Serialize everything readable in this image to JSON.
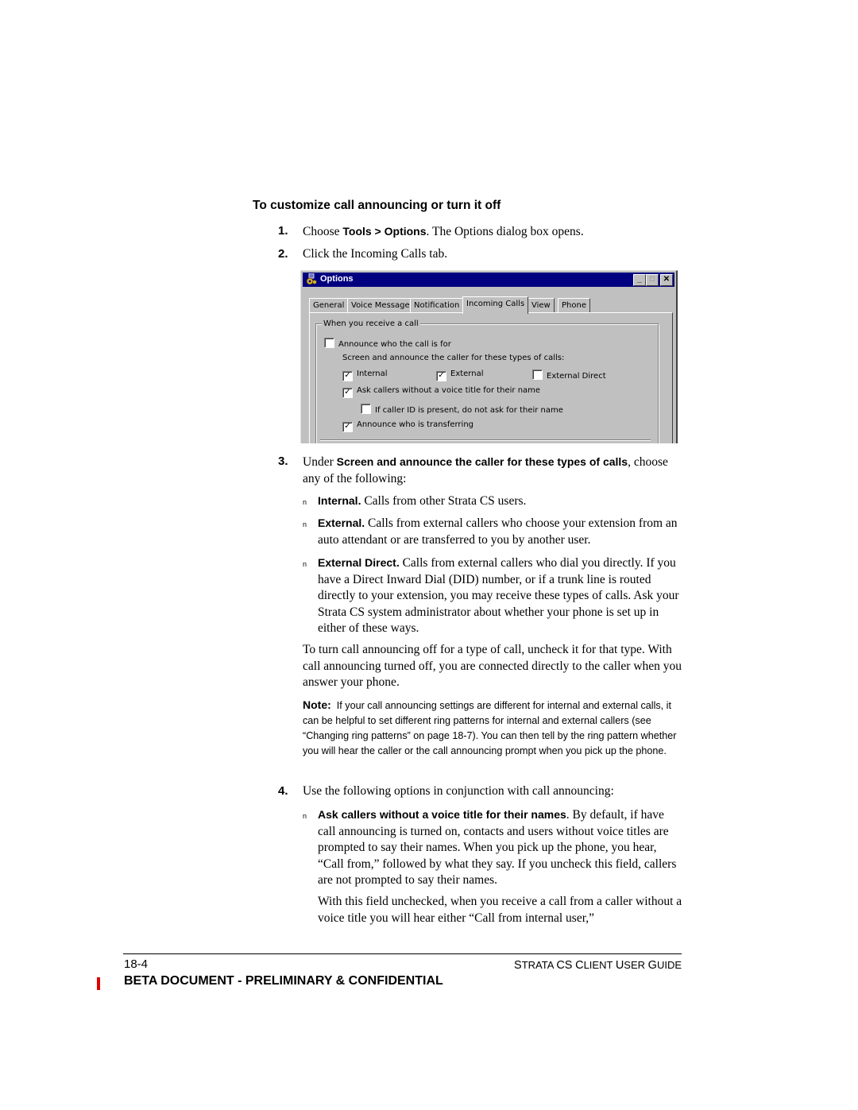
{
  "heading": "To customize call announcing or turn it off",
  "steps": [
    {
      "num": "1.",
      "pre": "Choose ",
      "bold": "Tools > Options",
      "post": ". The Options dialog box opens."
    },
    {
      "num": "2.",
      "text": "Click the Incoming Calls tab."
    },
    {
      "num": "3.",
      "pre": "Under ",
      "bold": "Screen and announce the caller for these types of calls",
      "post": ", choose any of the following:"
    },
    {
      "num": "4.",
      "text": "Use the following options in conjunction with call announcing:"
    }
  ],
  "bullet_marker": "n",
  "step3_bullets": [
    {
      "bold": "Internal.",
      "text": " Calls from other Strata CS users."
    },
    {
      "bold": "External.",
      "text": " Calls from external callers who choose your extension from an auto attendant or are transferred to you by another user."
    },
    {
      "bold": "External Direct.",
      "text": " Calls from external callers who dial you directly. If you have a Direct Inward Dial (DID) number, or if a trunk line is routed directly to your extension, you may receive these types of calls. Ask your Strata CS system administrator about whether your phone is set up in either of these ways."
    }
  ],
  "turn_off_para": "To turn call announcing off for a type of call, uncheck it for that type. With call announcing turned off, you are connected directly to the caller when you answer your phone.",
  "note": {
    "label": "Note:",
    "text": "If your call announcing settings are different for internal and external calls, it can be helpful to set different ring patterns for internal and external callers (see “Changing ring patterns” on page 18-7). You can then tell by the ring pattern whether you will hear the caller or the call announcing prompt when you pick up the phone."
  },
  "step4_bullets": [
    {
      "bold": "Ask callers without a voice title for their names",
      "text": ". By default, if have call announcing is turned on, contacts and users without voice titles are prompted to say their names. When you pick up the phone, you hear, “Call from,” followed by what they say. If you uncheck this field, callers are not prompted to say their names."
    }
  ],
  "step4_followup": "With this field unchecked, when you receive a call from a caller without a voice title you will hear either “Call from internal user,”",
  "dialog": {
    "title": "Options",
    "icon": "options-gear-icon",
    "controls": {
      "minimize": "_",
      "maximize": "□",
      "close": "✕"
    },
    "tabs": [
      {
        "label": "General",
        "active": false
      },
      {
        "label": "Voice Message",
        "active": false
      },
      {
        "label": "Notification",
        "active": false
      },
      {
        "label": "Incoming Calls",
        "active": true
      },
      {
        "label": "View",
        "active": false
      },
      {
        "label": "Phone",
        "active": false
      }
    ],
    "group_label": "When you receive a call",
    "announce_who_for": {
      "label": "Announce who the call is for",
      "checked": false
    },
    "screen_label": "Screen and announce the caller for these types of calls:",
    "types": [
      {
        "label": "Internal",
        "checked": true
      },
      {
        "label": "External",
        "checked": true
      },
      {
        "label": "External Direct",
        "checked": false
      }
    ],
    "ask_callers": {
      "label": "Ask callers without a voice title for their name",
      "checked": true
    },
    "caller_id": {
      "label": "If caller ID is present, do not ask for their name",
      "checked": false
    },
    "announce_transferring": {
      "label": "Announce who is transferring",
      "checked": true
    },
    "check_glyph": "✓"
  },
  "footer": {
    "page_number": "18-4",
    "guide_title": "Strata CS Client User Guide",
    "guide_parts": [
      {
        "big": "S",
        "small": "TRATA"
      },
      {
        "big": "CS",
        "small": ""
      },
      {
        "big": "C",
        "small": "LIENT"
      },
      {
        "big": "U",
        "small": "SER"
      },
      {
        "big": "G",
        "small": "UIDE"
      }
    ],
    "beta_notice": "BETA DOCUMENT - PRELIMINARY & CONFIDENTIAL",
    "change_bar_color": "#e00000"
  }
}
